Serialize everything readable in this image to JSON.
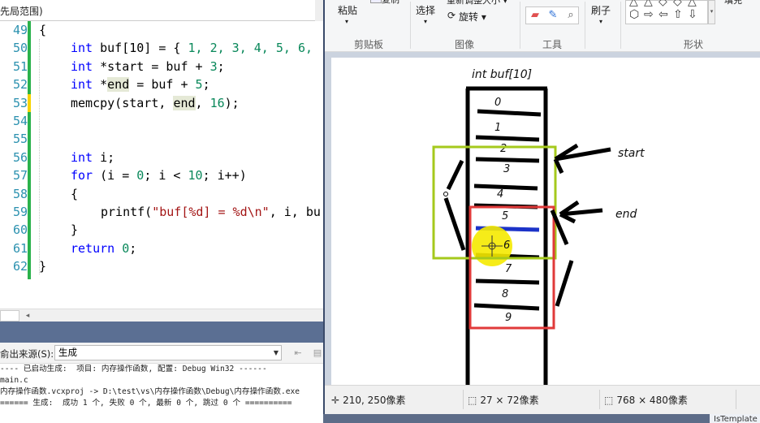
{
  "editor": {
    "tab_fragment": "先局范围)",
    "line_numbers": [
      "49",
      "50",
      "51",
      "52",
      "53",
      "54",
      "55",
      "56",
      "57",
      "58",
      "59",
      "60",
      "61",
      "62"
    ],
    "lines": {
      "l49": "{",
      "l50_kw": "int",
      "l50_rest": " buf[10] = { ",
      "l50_nums": "1, 2, 3, 4, 5, 6,",
      "l51_kw": "int",
      "l51_rest": " *start = buf + ",
      "l51_num": "3",
      "l51_end": ";",
      "l52_kw": "int",
      "l52_a": " *",
      "l52_hl": "end",
      "l52_b": " = buf + ",
      "l52_num": "5",
      "l52_end": ";",
      "l53_a": "memcpy(start, ",
      "l53_hl": "end",
      "l53_b": ", ",
      "l53_num": "16",
      "l53_end": ");",
      "l56_kw": "int",
      "l56_rest": " i;",
      "l57_kw": "for",
      "l57_a": " (i = ",
      "l57_n0": "0",
      "l57_b": "; i < ",
      "l57_n1": "10",
      "l57_c": "; i++)",
      "l58": "{",
      "l59_a": "printf(",
      "l59_str": "\"buf[%d] = %d\\n\"",
      "l59_b": ", i, bu",
      "l60": "}",
      "l61_kw": "return",
      "l61_sp": " ",
      "l61_num": "0",
      "l61_end": ";",
      "l62": "}"
    },
    "scroll_left": "◂"
  },
  "output": {
    "source_label": "俞出来源(S):",
    "source_value": "生成",
    "lines": [
      "---- 已启动生成:  项目: 内存操作函数, 配置: Debug Win32 ------",
      "main.c",
      "内存操作函数.vcxproj -> D:\\test\\vs\\内存操作函数\\Debug\\内存操作函数.exe",
      "====== 生成:  成功 1 个, 失败 0 个, 最新 0 个, 跳过 0 个 =========="
    ]
  },
  "paint": {
    "ribbon": {
      "paste": "粘贴",
      "clip_top": "复制",
      "select": "选择",
      "crop_top": "重新调整大小 ▾",
      "rotate": "旋转 ▾",
      "brush": "刷子",
      "fill": "填充",
      "groups": {
        "clipboard": "剪贴板",
        "image": "图像",
        "tools": "工具",
        "shapes": "形状"
      }
    },
    "status": {
      "cursor_pos": "210, 250像素",
      "selection_size": "27 × 72像素",
      "image_size": "768 × 480像素"
    },
    "canvas": {
      "array_label": "int buf[10]",
      "cells": [
        "0",
        "1",
        "2",
        "3",
        "4",
        "5",
        "6",
        "7",
        "8",
        "9"
      ],
      "start_label": "start",
      "end_label": "end"
    }
  },
  "taskbar": {
    "peek_label": "IsTemplate"
  },
  "colors": {
    "vs_keyword": "#0000ff",
    "vs_number": "#09885a",
    "vs_string": "#a31515",
    "vs_line_number": "#2b91af",
    "vs_change_bar": "#2bb24c",
    "green_box": "#a5c91c",
    "red_box": "#e03a3a",
    "highlight_circle": "#f5ea00",
    "blue_stroke": "#1c33c8"
  }
}
